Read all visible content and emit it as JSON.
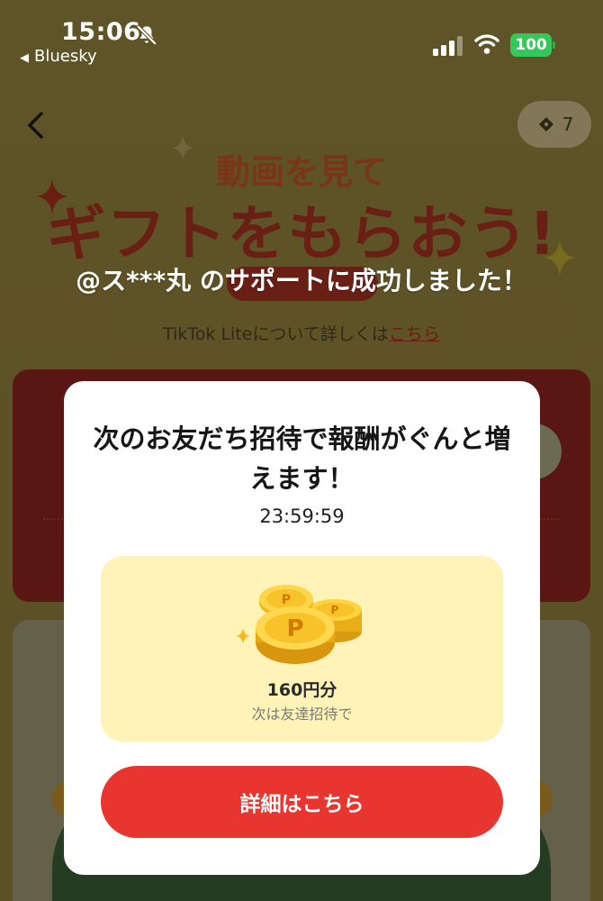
{
  "status_bar": {
    "time": "15:06",
    "back_app": "Bluesky",
    "battery": "100"
  },
  "header": {
    "ticket_count": "7"
  },
  "background": {
    "hero_subtitle": "動画を見て",
    "hero_title": "ギフトをもらおう!",
    "about_prefix": "TikTok Liteについて詳しくは",
    "about_link": "こちら"
  },
  "toast": {
    "message": "@ス***丸 のサポートに成功しました！"
  },
  "modal": {
    "title": "次のお友だち招待で報酬がぐんと増えます！",
    "countdown": "23:59:59",
    "reward_amount": "160円分",
    "reward_note": "次は友達招待で",
    "button_label": "詳細はこちら"
  },
  "colors": {
    "accent": "#e8352f",
    "reward_bg": "#fff3b8",
    "battery": "#34c759"
  },
  "icons": [
    "bell-slash-icon",
    "signal-icon",
    "wifi-icon",
    "back-arrow-icon",
    "ticket-icon",
    "coin-stack-icon",
    "sparkle-icon"
  ]
}
